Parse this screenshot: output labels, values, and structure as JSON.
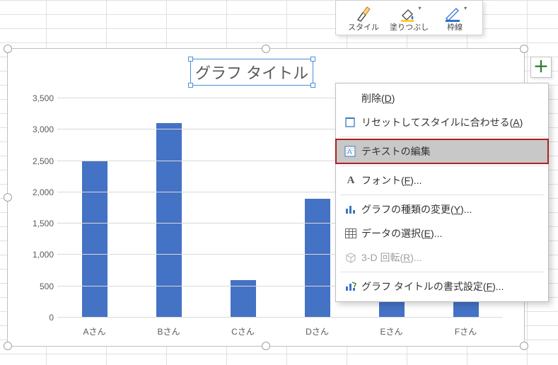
{
  "chart_title": "グラフ タイトル",
  "chart_data": {
    "type": "bar",
    "categories": [
      "Aさん",
      "Bさん",
      "Cさん",
      "Dさん",
      "Eさん",
      "Fさん"
    ],
    "values": [
      2500,
      3100,
      600,
      1900,
      400,
      400
    ],
    "title": "グラフ タイトル",
    "xlabel": "",
    "ylabel": "",
    "ylim": [
      0,
      3500
    ],
    "y_ticks": [
      0,
      500,
      1000,
      1500,
      2000,
      2500,
      3000,
      3500
    ],
    "grid": true
  },
  "y_tick_labels": [
    "0",
    "500",
    "1,000",
    "1,500",
    "2,000",
    "2,500",
    "3,000",
    "3,500"
  ],
  "mini_toolbar": {
    "style": "スタイル",
    "fill": "塗りつぶし",
    "outline": "枠線"
  },
  "context_menu": {
    "delete": {
      "pre": "削除(",
      "ul": "D",
      "post": ")"
    },
    "reset": {
      "pre": "リセットしてスタイルに合わせる(",
      "ul": "A",
      "post": ")"
    },
    "edit_text": "テキストの編集",
    "font": {
      "pre": "フォント(",
      "ul": "F",
      "post": ")..."
    },
    "change_type": {
      "pre": "グラフの種類の変更(",
      "ul": "Y",
      "post": ")..."
    },
    "select_data": {
      "pre": "データの選択(",
      "ul": "E",
      "post": ")..."
    },
    "rotate_3d": {
      "pre": "3-D 回転(",
      "ul": "R",
      "post": ")..."
    },
    "format_title": {
      "pre": "グラフ タイトルの書式設定(",
      "ul": "F",
      "post": ")..."
    }
  }
}
